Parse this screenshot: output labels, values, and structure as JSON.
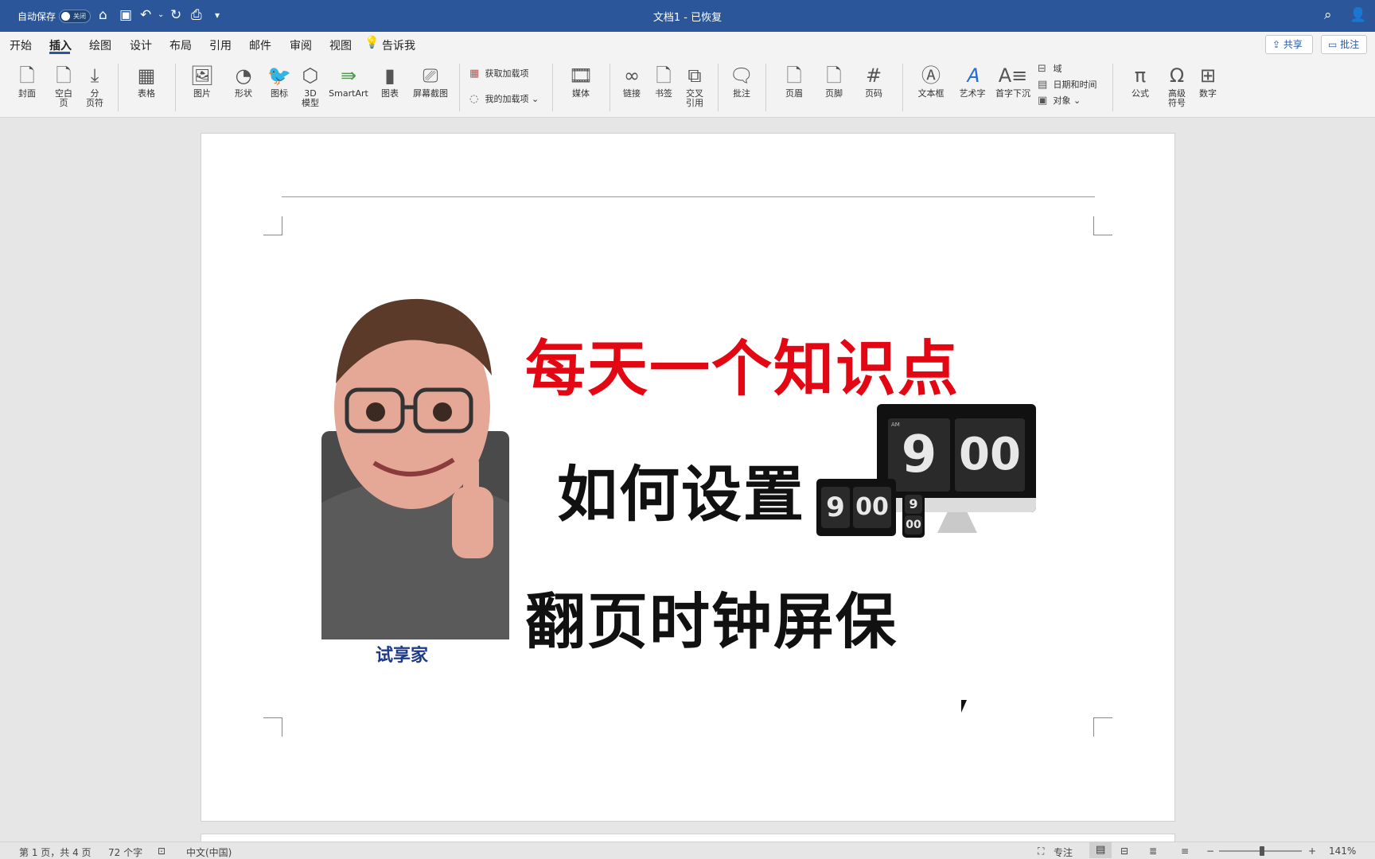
{
  "titlebar": {
    "autosave_label": "自动保存",
    "autosave_state": "关闭",
    "doc_title": "文档1 - 已恢复"
  },
  "tabs": [
    "开始",
    "插入",
    "绘图",
    "设计",
    "布局",
    "引用",
    "邮件",
    "审阅",
    "视图"
  ],
  "active_tab": "插入",
  "tell_me": "告诉我",
  "share_label": "共享",
  "comments_label": "批注",
  "ribbon": {
    "cover": "封面",
    "blank_page_1": "空白",
    "blank_page_2": "页",
    "page_break_1": "分",
    "page_break_2": "页符",
    "table": "表格",
    "pictures": "图片",
    "shapes": "形状",
    "icons": "图标",
    "models_1": "3D",
    "models_2": "模型",
    "smartart": "SmartArt",
    "chart": "图表",
    "screenshot": "屏幕截图",
    "get_addins": "获取加载项",
    "my_addins": "我的加载项",
    "media": "媒体",
    "link": "链接",
    "bookmark": "书签",
    "crossref_1": "交叉",
    "crossref_2": "引用",
    "comment": "批注",
    "header": "页眉",
    "footer": "页脚",
    "page_number": "页码",
    "textbox": "文本框",
    "wordart": "艺术字",
    "dropcap": "首字下沉",
    "field": "域",
    "datetime": "日期和时间",
    "object": "对象",
    "equation": "公式",
    "symbol_1": "高级",
    "symbol_2": "符号",
    "number": "数字"
  },
  "cover": {
    "line1": "每天一个知识点",
    "line2": "如何设置",
    "line3": "翻页时钟屏保",
    "caption": "试享家",
    "clock_hour": "9",
    "clock_min": "00",
    "clock_ampm": "AM"
  },
  "statusbar": {
    "page": "第 1 页，共 4 页",
    "words": "72 个字",
    "language": "中文(中国)",
    "focus": "专注",
    "zoom": "141%"
  },
  "colors": {
    "titlebar": "#2b579a",
    "headline_red": "#e30613",
    "headline_black": "#111111"
  }
}
